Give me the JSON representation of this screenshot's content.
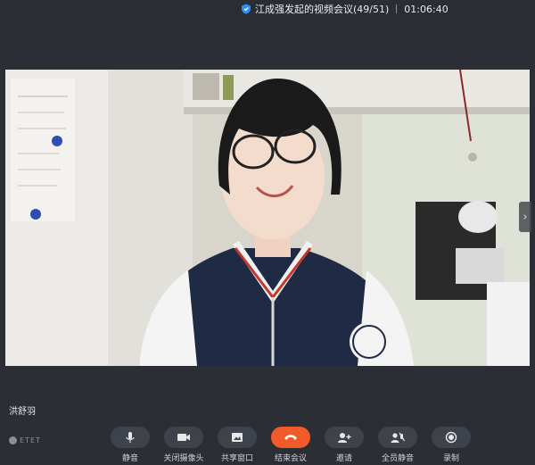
{
  "titlebar": {
    "meeting_title": "江成强发起的视频会议(49/51)",
    "elapsed": "01:06:40"
  },
  "participant": {
    "name": "洪舒羽"
  },
  "brand": {
    "logo_text": "ETET"
  },
  "toolbar": {
    "mute": "静音",
    "camera_off": "关闭摄像头",
    "share_window": "共享窗口",
    "end_meeting": "结束会议",
    "invite": "邀请",
    "mute_all": "全员静音",
    "record": "录制"
  },
  "colors": {
    "background": "#2b2f35",
    "button_bg": "#3e434b",
    "end_button": "#f25a2a"
  },
  "icons": [
    "shield-icon",
    "chevron-right-icon",
    "microphone-icon",
    "camera-icon",
    "share-screen-icon",
    "phone-hangup-icon",
    "add-user-icon",
    "mute-all-icon",
    "record-icon"
  ]
}
